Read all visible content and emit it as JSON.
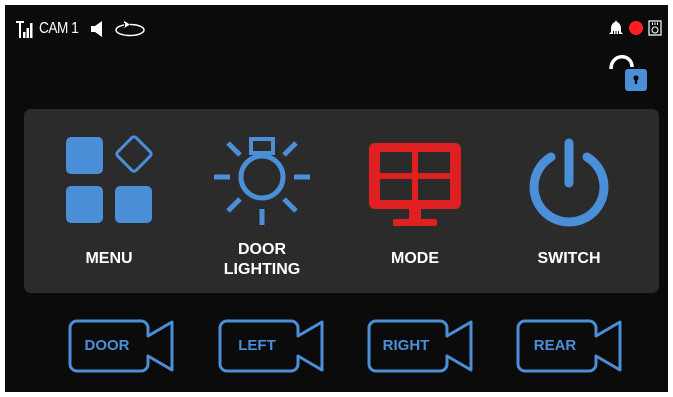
{
  "status_bar": {
    "camera_label": "CAM 1",
    "icons": [
      "signal-icon",
      "speaker-icon",
      "rotate-icon"
    ],
    "right_icons": [
      "bell-icon",
      "record-icon",
      "sd-card-icon"
    ],
    "record_color": "#ff1f1f"
  },
  "lock": {
    "icon": "unlocked-padlock-icon",
    "color": "#4a8fd8"
  },
  "menu_tiles": [
    {
      "label": "MENU",
      "icon": "menu-grid-icon"
    },
    {
      "label": "DOOR LIGHTING",
      "line1": "DOOR",
      "line2": "LIGHTING",
      "icon": "light-bulb-icon"
    },
    {
      "label": "MODE",
      "icon": "monitor-quad-icon"
    },
    {
      "label": "SWITCH",
      "icon": "power-icon"
    }
  ],
  "camera_buttons": [
    {
      "label": "DOOR",
      "icon": "camera-icon"
    },
    {
      "label": "LEFT",
      "icon": "camera-icon"
    },
    {
      "label": "RIGHT",
      "icon": "camera-icon"
    },
    {
      "label": "REAR",
      "icon": "camera-icon"
    }
  ],
  "colors": {
    "accent_blue": "#4a8fd8",
    "mode_red": "#e02020",
    "background": "#0b0b0b",
    "panel": "#2b2b2b"
  }
}
